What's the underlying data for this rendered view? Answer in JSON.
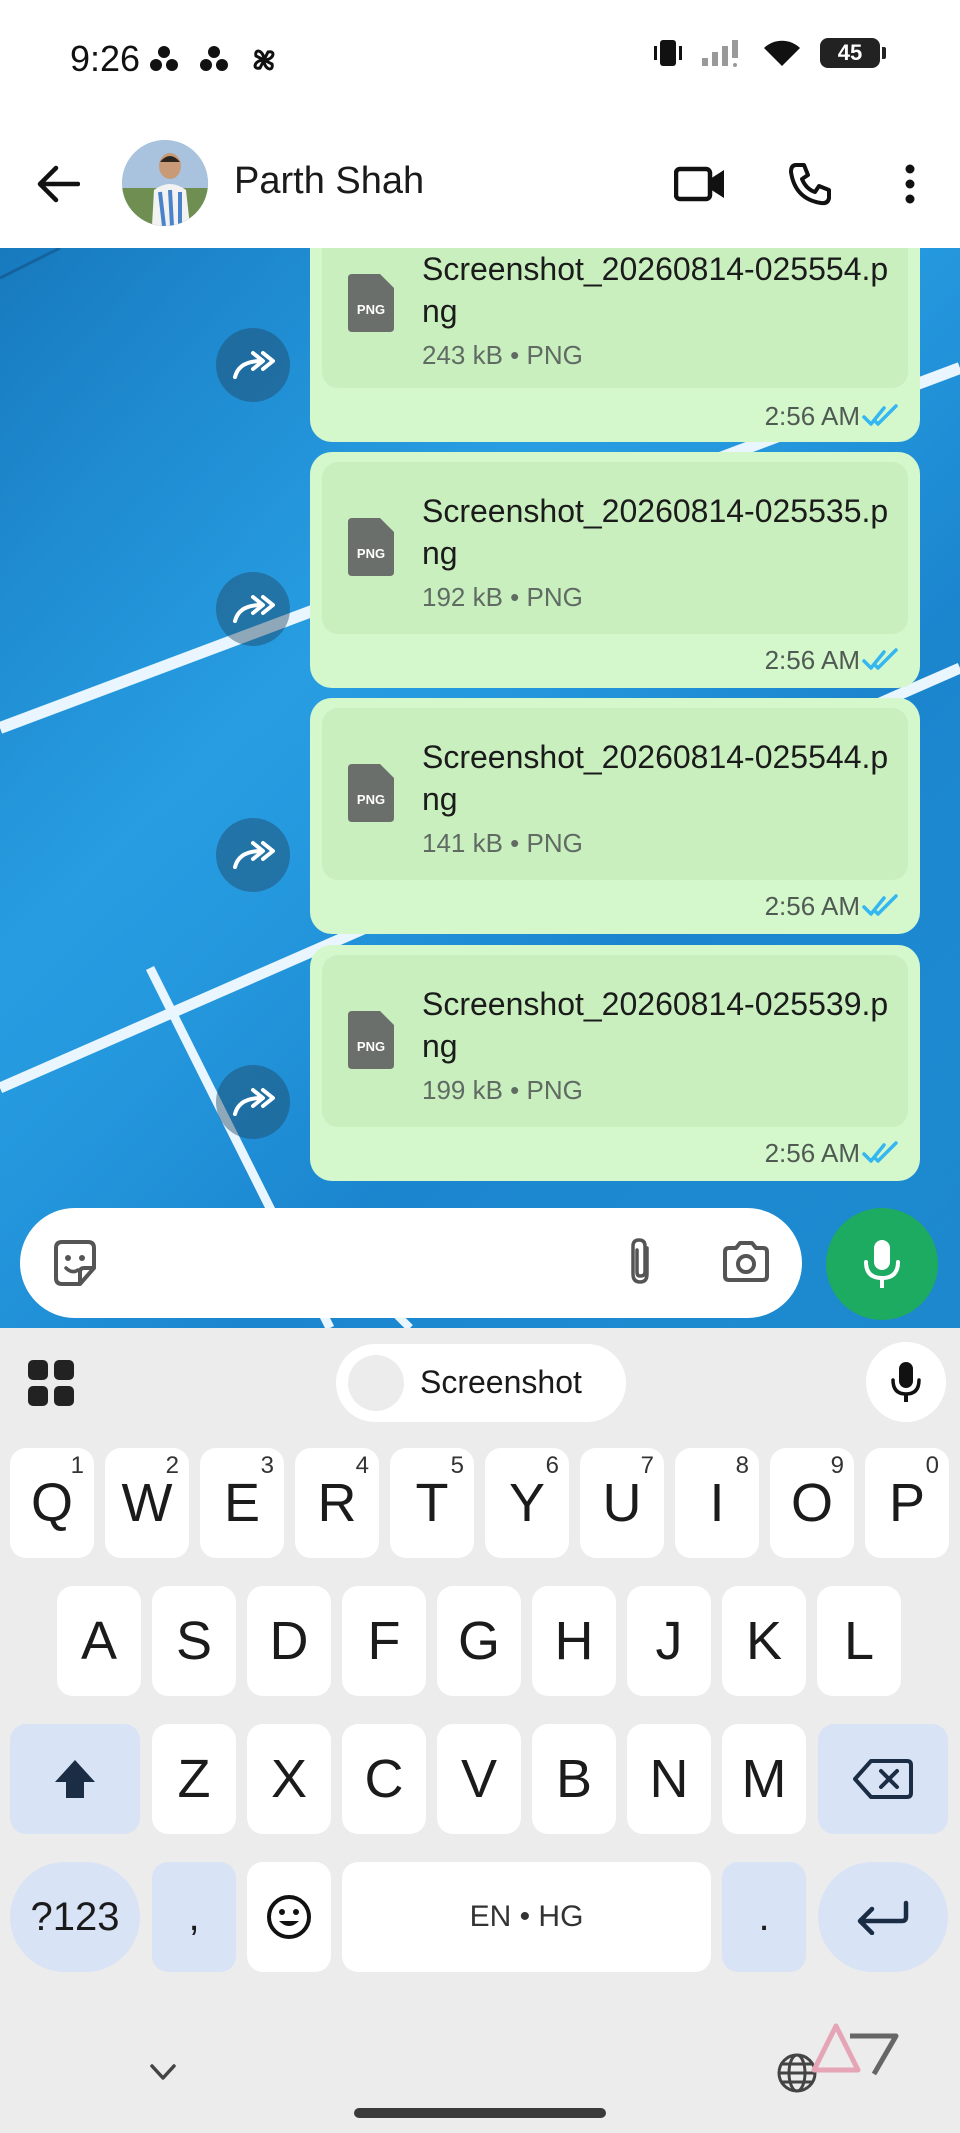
{
  "status_bar": {
    "time": "9:26",
    "battery": "45",
    "left_icons": [
      "notification-dots-icon",
      "notification-dots-icon",
      "pinwheel-icon"
    ],
    "right_icons": [
      "vibrate-icon",
      "signal-icon",
      "wifi-icon",
      "battery-icon"
    ]
  },
  "header": {
    "contact_name": "Parth Shah",
    "icons": [
      "back-arrow-icon",
      "video-call-icon",
      "phone-icon",
      "more-vert-icon"
    ]
  },
  "messages": [
    {
      "file_name": "Screenshot_20260814-025554.png",
      "size": "243 kB",
      "type": "PNG",
      "time": "2:56 AM",
      "status": "read"
    },
    {
      "file_name": "Screenshot_20260814-025535.png",
      "size": "192 kB",
      "type": "PNG",
      "time": "2:56 AM",
      "status": "read"
    },
    {
      "file_name": "Screenshot_20260814-025544.png",
      "size": "141 kB",
      "type": "PNG",
      "time": "2:56 AM",
      "status": "read"
    },
    {
      "file_name": "Screenshot_20260814-025539.png",
      "size": "199 kB",
      "type": "PNG",
      "time": "2:56 AM",
      "status": "read"
    }
  ],
  "file_badge": "PNG",
  "composer": {
    "placeholder": "",
    "icons": [
      "sticker-icon",
      "paperclip-icon",
      "camera-icon",
      "mic-icon"
    ]
  },
  "keyboard": {
    "suggestion": "Screenshot",
    "row1": [
      {
        "key": "Q",
        "hint": "1"
      },
      {
        "key": "W",
        "hint": "2"
      },
      {
        "key": "E",
        "hint": "3"
      },
      {
        "key": "R",
        "hint": "4"
      },
      {
        "key": "T",
        "hint": "5"
      },
      {
        "key": "Y",
        "hint": "6"
      },
      {
        "key": "U",
        "hint": "7"
      },
      {
        "key": "I",
        "hint": "8"
      },
      {
        "key": "O",
        "hint": "9"
      },
      {
        "key": "P",
        "hint": "0"
      }
    ],
    "row2": [
      "A",
      "S",
      "D",
      "F",
      "G",
      "H",
      "J",
      "K",
      "L"
    ],
    "row3": [
      "Z",
      "X",
      "C",
      "V",
      "B",
      "N",
      "M"
    ],
    "symbols_key": "?123",
    "comma_key": ",",
    "space_label": "EN • HG",
    "period_key": ".",
    "icons": [
      "apps-grid-icon",
      "keyboard-mic-icon",
      "shift-icon",
      "backspace-icon",
      "emoji-icon",
      "enter-icon",
      "collapse-chevron-icon",
      "globe-icon"
    ]
  },
  "colors": {
    "bubble": "#d5f7cc",
    "doc_card": "#c9efbf",
    "send_button": "#1daa61",
    "read_ticks": "#34b7f1",
    "keyboard_func": "#d9e3f6"
  }
}
